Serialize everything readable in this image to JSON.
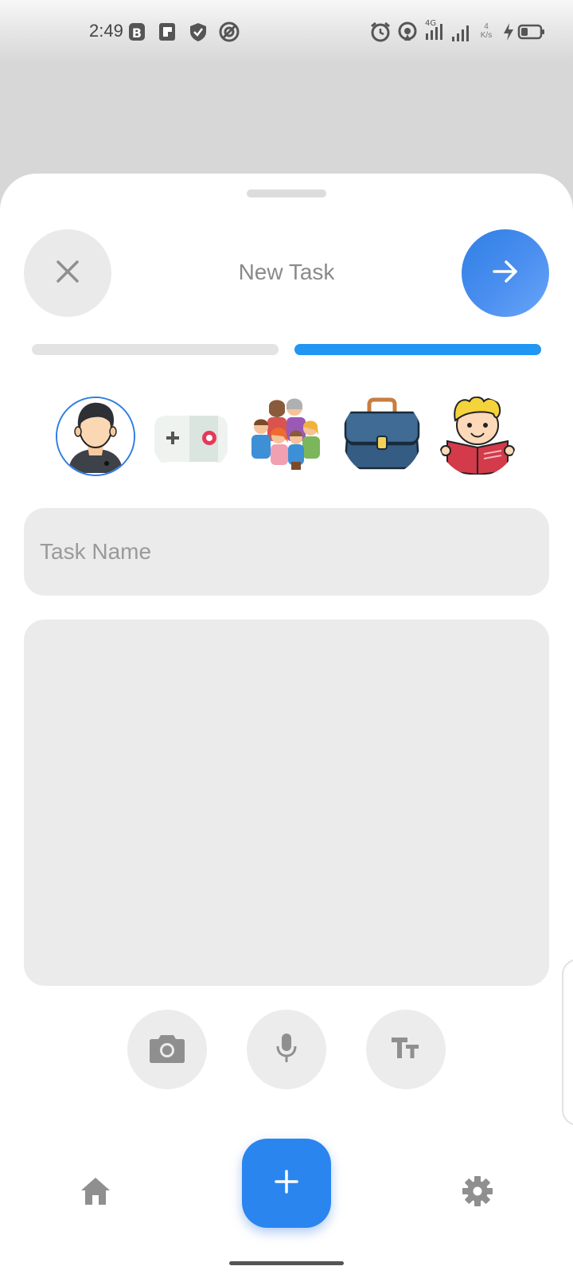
{
  "status_bar": {
    "time": "2:49",
    "network_label": "4G",
    "speed_value": "4",
    "speed_unit": "K/s",
    "left_icons": [
      "b-app-icon",
      "p-app-icon",
      "shield-icon",
      "blocked-icon"
    ],
    "right_icons": [
      "alarm-icon",
      "hotspot-icon",
      "signal-4g-icon",
      "signal-icon",
      "charging-icon",
      "battery-icon"
    ]
  },
  "header": {
    "title": "New Task",
    "close_icon": "close-icon",
    "next_icon": "arrow-right-icon"
  },
  "progress": {
    "steps_total": 2,
    "current_step": 2,
    "inactive_color": "#e3e3e3",
    "active_color": "#2196f3"
  },
  "categories": [
    {
      "name": "personal",
      "icon": "person-avatar-icon",
      "selected": true
    },
    {
      "name": "games",
      "icon": "gamepad-icon",
      "selected": false
    },
    {
      "name": "family",
      "icon": "family-icon",
      "selected": false
    },
    {
      "name": "work",
      "icon": "briefcase-icon",
      "selected": false
    },
    {
      "name": "study",
      "icon": "reading-boy-icon",
      "selected": false
    }
  ],
  "form": {
    "task_name_placeholder": "Task Name",
    "task_name_value": "",
    "notes_value": ""
  },
  "tools": [
    "camera-icon",
    "microphone-icon",
    "text-size-icon"
  ],
  "bottom_nav": {
    "home_icon": "home-icon",
    "add_icon": "plus-icon",
    "settings_icon": "gear-icon"
  },
  "colors": {
    "accent": "#2a86ee",
    "selected_ring": "#2d7de6",
    "field_bg": "#ebebeb",
    "icon_gray": "#8f8f8f"
  }
}
